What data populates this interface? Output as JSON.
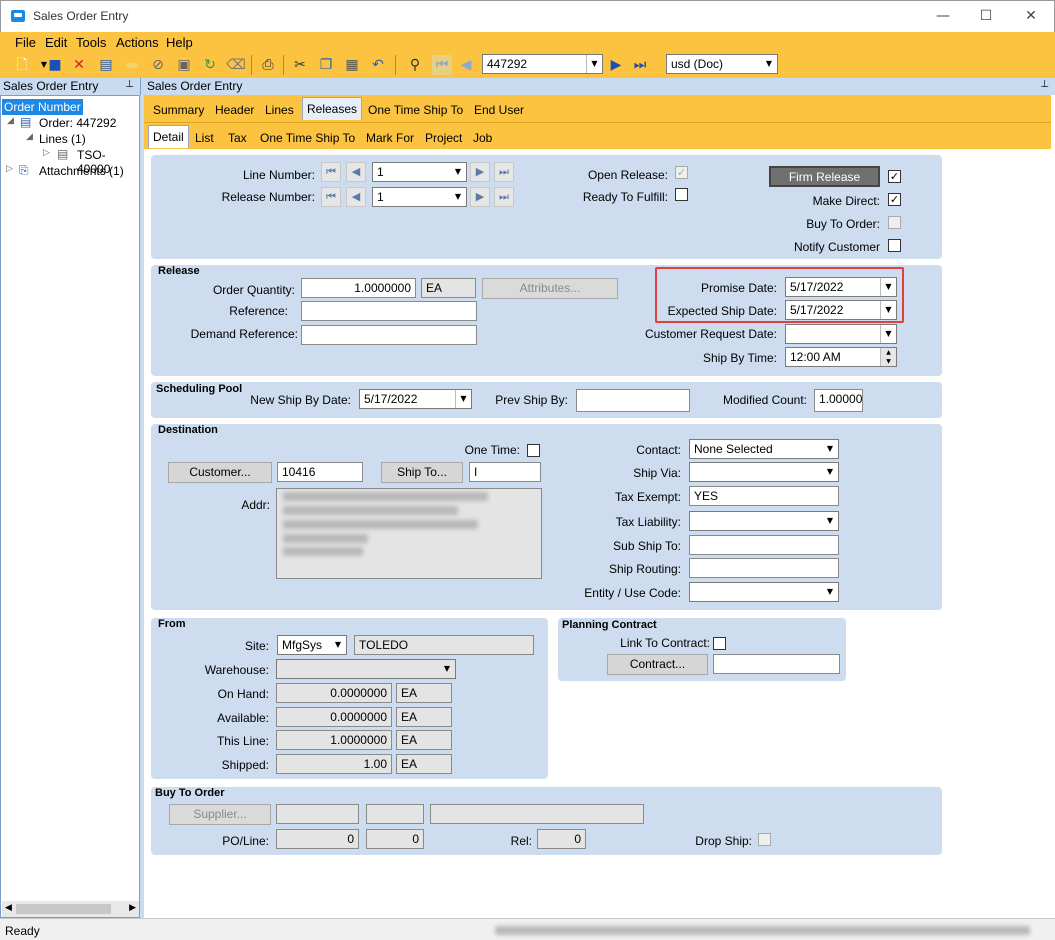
{
  "window": {
    "title": "Sales Order Entry",
    "min": "—",
    "max": "☐",
    "close": "✕"
  },
  "menu": [
    "File",
    "Edit",
    "Tools",
    "Actions",
    "Help"
  ],
  "toolbar": {
    "order_value": "447292",
    "currency": "usd (Doc)"
  },
  "left_panel": {
    "header": "Sales Order Entry",
    "selected": "Order Number",
    "order": "Order: 447292",
    "lines": "Lines (1)",
    "tso": "TSO-40000",
    "attachments": "Attachments (1)"
  },
  "main_header": "Sales Order Entry",
  "tabs": [
    "Summary",
    "Header",
    "Lines",
    "Releases",
    "One Time Ship To",
    "End User"
  ],
  "active_tab": "Releases",
  "subtabs": [
    "Detail",
    "List",
    "Tax",
    "One Time Ship To",
    "Mark For",
    "Project",
    "Job"
  ],
  "active_subtab": "Detail",
  "top": {
    "line_number_label": "Line Number:",
    "line_number": "1",
    "release_number_label": "Release Number:",
    "release_number": "1",
    "open_release_label": "Open Release:",
    "ready_to_fulfill_label": "Ready To Fulfill:",
    "firm_release_button": "Firm Release",
    "make_direct_label": "Make Direct:",
    "buy_to_order_label": "Buy To Order:",
    "notify_customer_label": "Notify Customer"
  },
  "release": {
    "title": "Release",
    "order_qty_label": "Order Quantity:",
    "order_qty": "1.0000000",
    "order_uom": "EA",
    "attributes_button": "Attributes...",
    "reference_label": "Reference:",
    "reference": "",
    "demand_reference_label": "Demand Reference:",
    "demand_reference": "",
    "promise_date_label": "Promise Date:",
    "promise_date": "5/17/2022",
    "expected_ship_label": "Expected Ship Date:",
    "expected_ship": "5/17/2022",
    "customer_request_label": "Customer Request Date:",
    "customer_request": "",
    "ship_by_time_label": "Ship By Time:",
    "ship_by_time": "12:00 AM"
  },
  "scheduling": {
    "title": "Scheduling Pool",
    "new_ship_by_label": "New Ship By Date:",
    "new_ship_by": "5/17/2022",
    "prev_ship_by_label": "Prev Ship By:",
    "prev_ship_by": "",
    "modified_count_label": "Modified Count:",
    "modified_count": "1.000000"
  },
  "destination": {
    "title": "Destination",
    "one_time_label": "One Time:",
    "customer_button": "Customer...",
    "customer": "10416",
    "ship_to_button": "Ship To...",
    "ship_to": "I",
    "addr_label": "Addr:",
    "contact_label": "Contact:",
    "contact": "None Selected",
    "ship_via_label": "Ship Via:",
    "ship_via": "",
    "tax_exempt_label": "Tax Exempt:",
    "tax_exempt": "YES",
    "tax_liability_label": "Tax Liability:",
    "tax_liability": "",
    "sub_ship_to_label": "Sub Ship To:",
    "sub_ship_to": "",
    "ship_routing_label": "Ship Routing:",
    "ship_routing": "",
    "entity_label": "Entity / Use Code:",
    "entity": ""
  },
  "from": {
    "title": "From",
    "site_label": "Site:",
    "site": "MfgSys",
    "site_name": "TOLEDO",
    "warehouse_label": "Warehouse:",
    "warehouse": "",
    "on_hand_label": "On Hand:",
    "on_hand": "0.0000000",
    "on_hand_uom": "EA",
    "available_label": "Available:",
    "available": "0.0000000",
    "available_uom": "EA",
    "this_line_label": "This Line:",
    "this_line": "1.0000000",
    "this_line_uom": "EA",
    "shipped_label": "Shipped:",
    "shipped": "1.00",
    "shipped_uom": "EA"
  },
  "planning": {
    "title": "Planning Contract",
    "link_label": "Link To Contract:",
    "contract_button": "Contract...",
    "contract": ""
  },
  "buy_to_order": {
    "title": "Buy To Order",
    "supplier_button": "Supplier...",
    "po_line_label": "PO/Line:",
    "po": "0",
    "line": "0",
    "rel_label": "Rel:",
    "rel": "0",
    "drop_ship_label": "Drop Ship:"
  },
  "status": {
    "text": "Ready"
  }
}
